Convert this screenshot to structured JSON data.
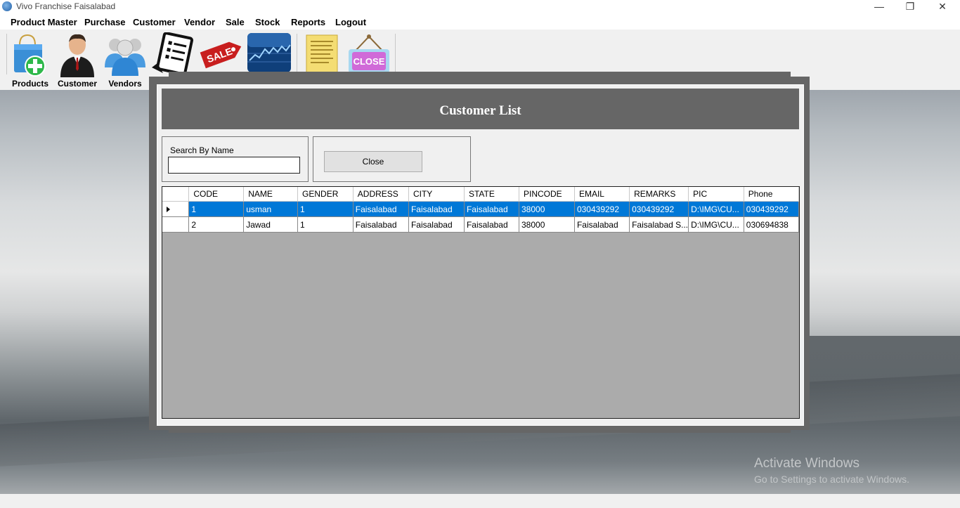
{
  "window": {
    "title": "Vivo Franchise Faisalabad",
    "minimize": "—",
    "restore": "❐",
    "close": "✕"
  },
  "menu": [
    "Product Master",
    "Purchase",
    "Customer",
    "Vendor",
    "Sale",
    "Stock",
    "Reports",
    "Logout"
  ],
  "toolbar": {
    "products": "Products",
    "customer": "Customer",
    "vendors": "Vendors",
    "sale_tag": "SALE",
    "close_sign": "CLOSE"
  },
  "dialog": {
    "title": "Customer List",
    "search_label": "Search By Name",
    "search_value": "",
    "close_button": "Close"
  },
  "grid": {
    "columns": [
      "CODE",
      "NAME",
      "GENDER",
      "ADDRESS",
      "CITY",
      "STATE",
      "PINCODE",
      "EMAIL",
      "REMARKS",
      "PIC",
      "Phone"
    ],
    "rows": [
      {
        "selected": true,
        "cells": [
          "1",
          "usman",
          "1",
          "Faisalabad",
          "Faisalabad",
          "Faisalabad",
          "38000",
          "030439292",
          "030439292",
          "D:\\IMG\\CU...",
          "030439292"
        ]
      },
      {
        "selected": false,
        "cells": [
          "2",
          "Jawad",
          "1",
          "Faisalabad",
          "Faisalabad",
          "Faisalabad",
          "38000",
          "Faisalabad",
          "Faisalabad S...",
          "D:\\IMG\\CU...",
          "030694838"
        ]
      }
    ]
  },
  "watermark": {
    "line1": "Activate Windows",
    "line2": "Go to Settings to activate Windows."
  }
}
